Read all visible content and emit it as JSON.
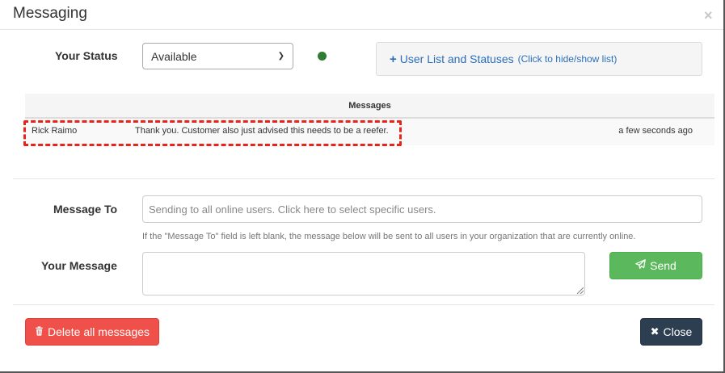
{
  "dialog": {
    "title": "Messaging",
    "close_glyph": "×"
  },
  "status": {
    "label": "Your Status",
    "selected": "Available",
    "indicator_color": "#2e7d32"
  },
  "user_list": {
    "plus": "+",
    "label": "User List and Statuses",
    "hint": "(Click to hide/show list)"
  },
  "messages": {
    "header": "Messages",
    "rows": [
      {
        "sender": "Rick Raimo",
        "text": "Thank you. Customer also just advised this needs to be a reefer.",
        "time": "a few seconds ago"
      }
    ]
  },
  "compose": {
    "to_label": "Message To",
    "to_placeholder": "Sending to all online users. Click here to select specific users.",
    "help": "If the \"Message To\" field is left blank, the message below will be sent to all users in your organization that are currently online.",
    "message_label": "Your Message",
    "message_value": "",
    "send_label": "Send"
  },
  "footer": {
    "delete_label": "Delete all messages",
    "close_label": "Close",
    "close_glyph": "✖"
  },
  "icons": {
    "send": "paper-plane-icon",
    "delete": "trash-icon",
    "close": "times-icon",
    "select_chevron": "chevron-down-icon"
  }
}
